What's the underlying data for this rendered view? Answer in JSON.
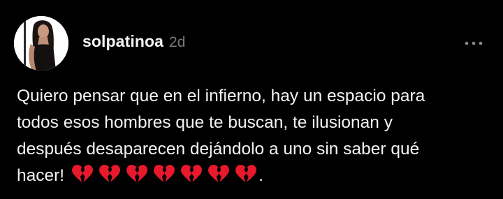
{
  "post": {
    "author": {
      "username": "solpatinoa",
      "timestamp": "2d",
      "avatar_icon": "profile-photo"
    },
    "more_icon": "more-horizontal-icon",
    "text_lines": [
      "Quiero pensar que en el infierno, hay un espacio para",
      "todos esos hombres que te buscan, te ilusionan y",
      "después desaparecen dejándolo a uno sin saber qué",
      "hacer!"
    ],
    "trailing_punctuation": ".",
    "emoji": {
      "name": "broken-heart-icon",
      "count": 7,
      "color": "#e8192c"
    }
  },
  "colors": {
    "background": "#000000",
    "text": "#f3f3f3",
    "muted": "#7a7a7a"
  }
}
